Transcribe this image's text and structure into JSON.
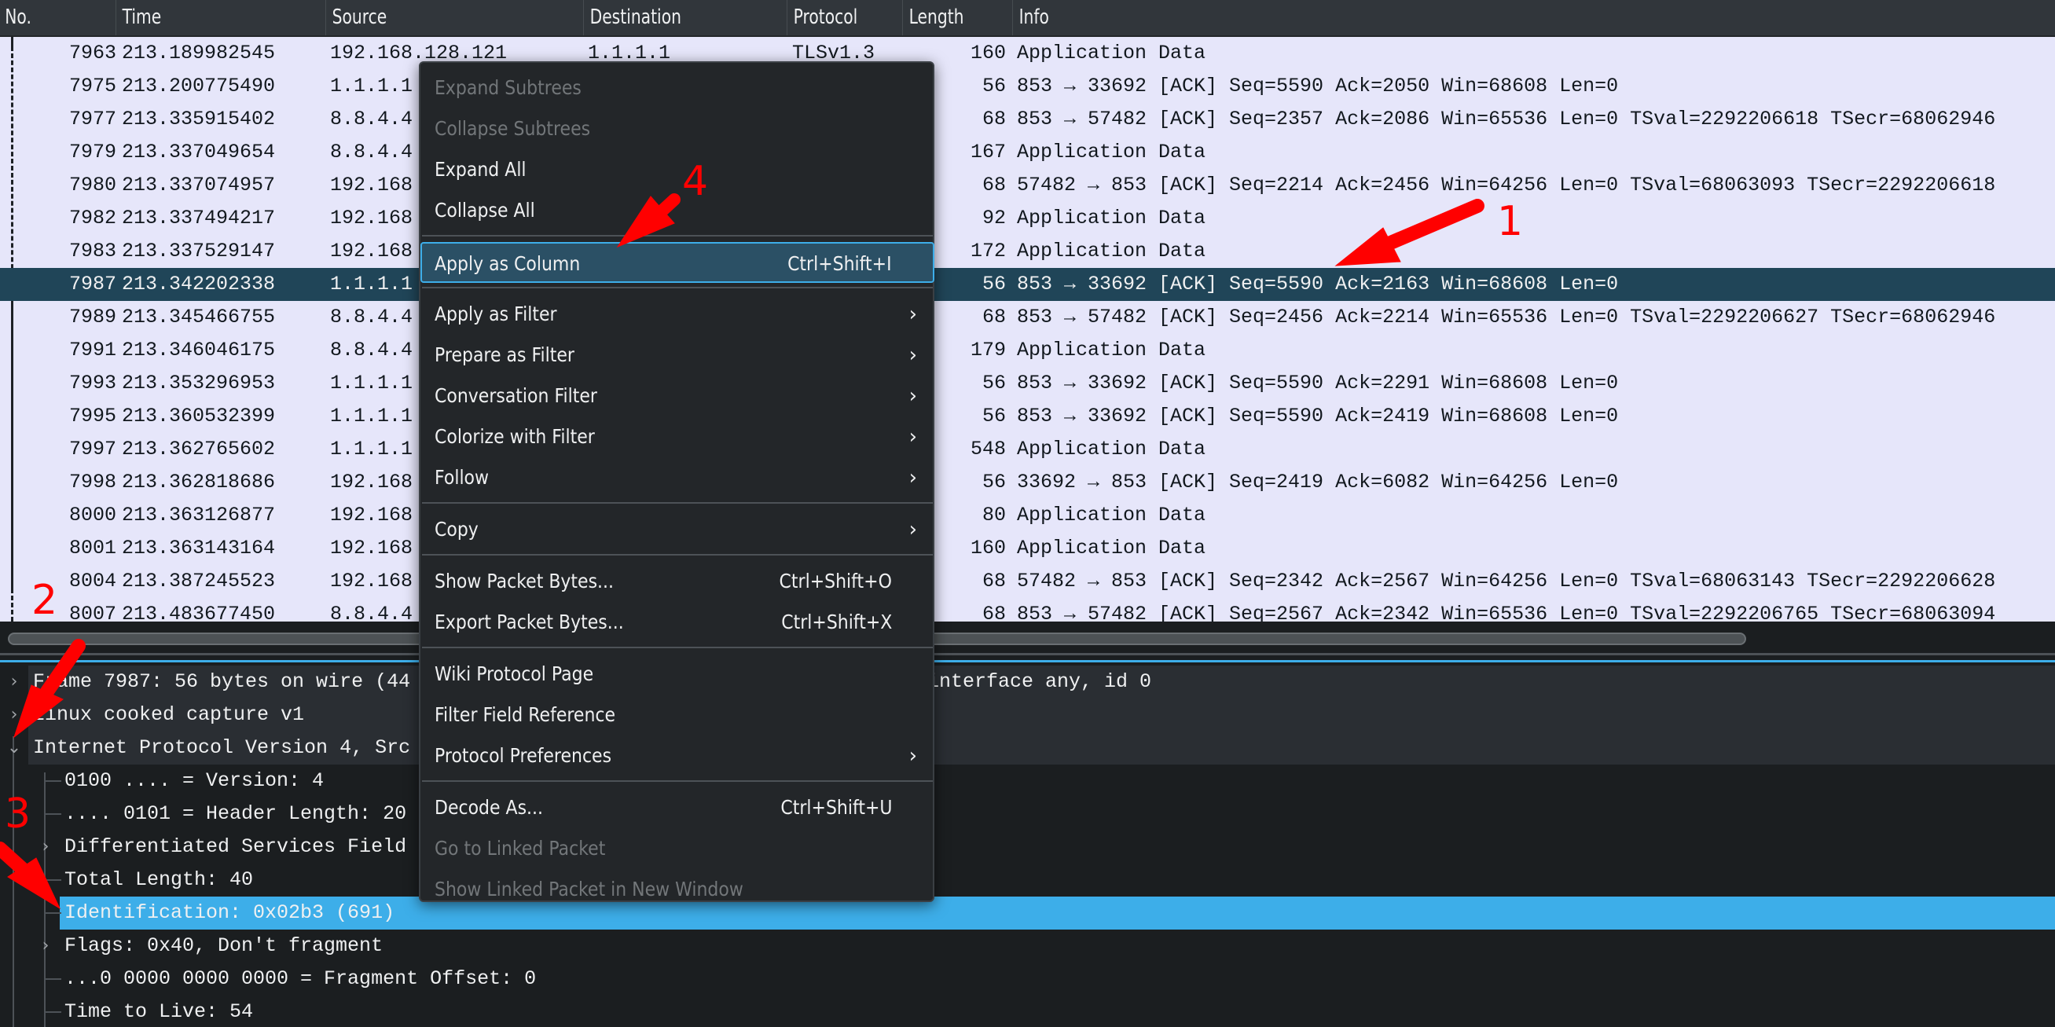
{
  "packet_list": {
    "columns": [
      "No.",
      "Time",
      "Source",
      "Destination",
      "Protocol",
      "Length",
      "Info"
    ],
    "selected_no": "7987",
    "rows": [
      {
        "no": "7963",
        "time": "213.189982545",
        "src": "192.168.128.121",
        "dst": "1.1.1.1",
        "proto": "TLSv1.3",
        "len": "160",
        "info": "Application Data"
      },
      {
        "no": "7975",
        "time": "213.200775490",
        "src": "1.1.1.1",
        "dst": "",
        "proto": "",
        "len": "56",
        "info": "853 → 33692 [ACK] Seq=5590 Ack=2050 Win=68608 Len=0"
      },
      {
        "no": "7977",
        "time": "213.335915402",
        "src": "8.8.4.4",
        "dst": "",
        "proto": "",
        "len": "68",
        "info": "853 → 57482 [ACK] Seq=2357 Ack=2086 Win=65536 Len=0 TSval=2292206618 TSecr=68062946"
      },
      {
        "no": "7979",
        "time": "213.337049654",
        "src": "8.8.4.4",
        "dst": "",
        "proto": "",
        "len": "167",
        "info": "Application Data"
      },
      {
        "no": "7980",
        "time": "213.337074957",
        "src": "192.168",
        "dst": "",
        "proto": "",
        "len": "68",
        "info": "57482 → 853 [ACK] Seq=2214 Ack=2456 Win=64256 Len=0 TSval=68063093 TSecr=2292206618"
      },
      {
        "no": "7982",
        "time": "213.337494217",
        "src": "192.168",
        "dst": "",
        "proto": "",
        "len": "92",
        "info": "Application Data"
      },
      {
        "no": "7983",
        "time": "213.337529147",
        "src": "192.168",
        "dst": "",
        "proto": "",
        "len": "172",
        "info": "Application Data"
      },
      {
        "no": "7987",
        "time": "213.342202338",
        "src": "1.1.1.1",
        "dst": "",
        "proto": "",
        "len": "56",
        "info": "853 → 33692 [ACK] Seq=5590 Ack=2163 Win=68608 Len=0"
      },
      {
        "no": "7989",
        "time": "213.345466755",
        "src": "8.8.4.4",
        "dst": "",
        "proto": "",
        "len": "68",
        "info": "853 → 57482 [ACK] Seq=2456 Ack=2214 Win=65536 Len=0 TSval=2292206627 TSecr=68062946"
      },
      {
        "no": "7991",
        "time": "213.346046175",
        "src": "8.8.4.4",
        "dst": "",
        "proto": "",
        "len": "179",
        "info": "Application Data"
      },
      {
        "no": "7993",
        "time": "213.353296953",
        "src": "1.1.1.1",
        "dst": "",
        "proto": "",
        "len": "56",
        "info": "853 → 33692 [ACK] Seq=5590 Ack=2291 Win=68608 Len=0"
      },
      {
        "no": "7995",
        "time": "213.360532399",
        "src": "1.1.1.1",
        "dst": "",
        "proto": "",
        "len": "56",
        "info": "853 → 33692 [ACK] Seq=5590 Ack=2419 Win=68608 Len=0"
      },
      {
        "no": "7997",
        "time": "213.362765602",
        "src": "1.1.1.1",
        "dst": "",
        "proto": "",
        "len": "548",
        "info": "Application Data"
      },
      {
        "no": "7998",
        "time": "213.362818686",
        "src": "192.168",
        "dst": "",
        "proto": "",
        "len": "56",
        "info": "33692 → 853 [ACK] Seq=2419 Ack=6082 Win=64256 Len=0"
      },
      {
        "no": "8000",
        "time": "213.363126877",
        "src": "192.168",
        "dst": "",
        "proto": "",
        "len": "80",
        "info": "Application Data"
      },
      {
        "no": "8001",
        "time": "213.363143164",
        "src": "192.168",
        "dst": "",
        "proto": "",
        "len": "160",
        "info": "Application Data"
      },
      {
        "no": "8004",
        "time": "213.387245523",
        "src": "192.168",
        "dst": "",
        "proto": "",
        "len": "68",
        "info": "57482 → 853 [ACK] Seq=2342 Ack=2567 Win=64256 Len=0 TSval=68063143 TSecr=2292206628"
      },
      {
        "no": "8007",
        "time": "213.483677450",
        "src": "8.8.4.4",
        "dst": "",
        "proto": "",
        "len": "68",
        "info": "853 → 57482 [ACK] Seq=2567 Ack=2342 Win=65536 Len=0 TSval=2292206765 TSecr=68063094"
      }
    ]
  },
  "detail_tree": [
    {
      "level": 0,
      "expander": "collapsed",
      "text": "Frame 7987: 56 bytes on wire (44",
      "text_right": "interface any, id 0"
    },
    {
      "level": 0,
      "expander": "collapsed",
      "text": "Linux cooked capture v1"
    },
    {
      "level": 0,
      "expander": "expanded",
      "text": "Internet Protocol Version 4, Src"
    },
    {
      "level": 1,
      "expander": "none",
      "text": "0100 .... = Version: 4"
    },
    {
      "level": 1,
      "expander": "none",
      "text": ".... 0101 = Header Length: 20"
    },
    {
      "level": 1,
      "expander": "collapsed",
      "text": "Differentiated Services Field"
    },
    {
      "level": 1,
      "expander": "none",
      "text": "Total Length: 40"
    },
    {
      "level": 1,
      "expander": "none",
      "text": "Identification: 0x02b3 (691)",
      "selected": true
    },
    {
      "level": 1,
      "expander": "collapsed",
      "text": "Flags: 0x40, Don't fragment"
    },
    {
      "level": 1,
      "expander": "none",
      "text": "...0 0000 0000 0000 = Fragment Offset: 0"
    },
    {
      "level": 1,
      "expander": "none",
      "text": "Time to Live: 54"
    }
  ],
  "context_menu": {
    "items": [
      {
        "label": "Expand Subtrees",
        "disabled": true
      },
      {
        "label": "Collapse Subtrees",
        "disabled": true
      },
      {
        "label": "Expand All"
      },
      {
        "label": "Collapse All"
      },
      {
        "separator": true
      },
      {
        "label": "Apply as Column",
        "shortcut": "Ctrl+Shift+I",
        "active": true
      },
      {
        "separator": true
      },
      {
        "label": "Apply as Filter",
        "submenu": true
      },
      {
        "label": "Prepare as Filter",
        "submenu": true
      },
      {
        "label": "Conversation Filter",
        "submenu": true
      },
      {
        "label": "Colorize with Filter",
        "submenu": true
      },
      {
        "label": "Follow",
        "submenu": true
      },
      {
        "separator": true
      },
      {
        "label": "Copy",
        "submenu": true
      },
      {
        "separator": true
      },
      {
        "label": "Show Packet Bytes...",
        "shortcut": "Ctrl+Shift+O"
      },
      {
        "label": "Export Packet Bytes...",
        "shortcut": "Ctrl+Shift+X"
      },
      {
        "separator": true
      },
      {
        "label": "Wiki Protocol Page"
      },
      {
        "label": "Filter Field Reference"
      },
      {
        "label": "Protocol Preferences",
        "submenu": true
      },
      {
        "separator": true
      },
      {
        "label": "Decode As...",
        "shortcut": "Ctrl+Shift+U"
      },
      {
        "label": "Go to Linked Packet",
        "disabled": true
      },
      {
        "label": "Show Linked Packet in New Window",
        "disabled": true
      }
    ]
  },
  "annotations": {
    "color": "#ff0000",
    "labels": [
      "1",
      "2",
      "3",
      "4"
    ]
  },
  "colors": {
    "row_bg": "#e6e6fa",
    "selected_row_bg": "#204558",
    "selected_field_bg": "#3daee9",
    "menu_bg": "#232629",
    "menu_active_bg": "#2b5065"
  },
  "icons": {
    "expander_collapsed": "›",
    "expander_expanded": "⌄",
    "submenu_arrow": "›"
  }
}
